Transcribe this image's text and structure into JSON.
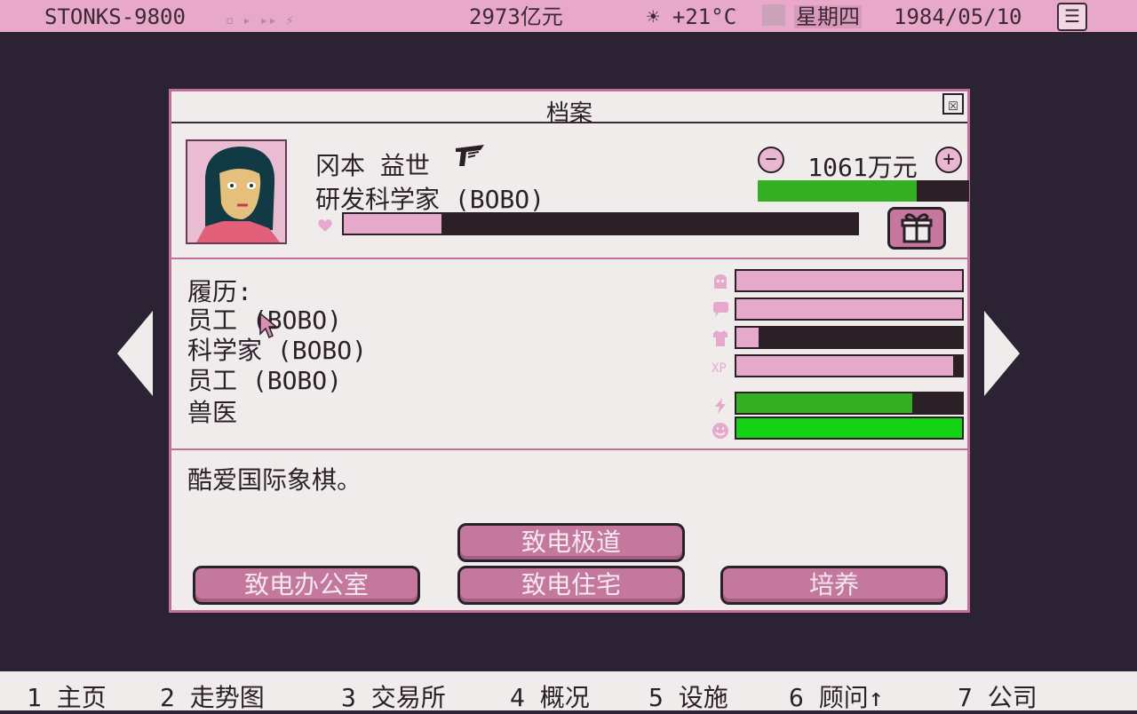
{
  "topbar": {
    "app_name": "STONKS-9800",
    "status_icons": "▫ ▸ ▸▸ ⚡",
    "money": "2973亿元",
    "weather": "☀ +21°C",
    "weekday": "星期四",
    "date": "1984/05/10",
    "menu_icon": "☰"
  },
  "dialog": {
    "title": "档案",
    "close_icon": "☒",
    "employee": {
      "name": "冈本 益世",
      "role": "研发科学家 (BOBO)",
      "loyalty_fraction": 0.19,
      "salary": "1061万元",
      "salary_fraction": 0.75
    },
    "history": {
      "label": "履历:",
      "items": [
        "员工 (BOBO)",
        "科学家 (BOBO)",
        "员工 (BOBO)",
        "兽医"
      ]
    },
    "stats": [
      {
        "icon": "head-icon",
        "fraction": 1.0,
        "color": "#e7a9cb"
      },
      {
        "icon": "speech-icon",
        "fraction": 1.0,
        "color": "#e7a9cb"
      },
      {
        "icon": "shirt-icon",
        "fraction": 0.1,
        "color": "#e7a9cb"
      },
      {
        "icon": "xp-icon",
        "fraction": 0.96,
        "color": "#e7a9cb"
      },
      {
        "icon": "energy-icon",
        "fraction": 0.78,
        "color": "#35b025"
      },
      {
        "icon": "mood-icon",
        "fraction": 1.0,
        "color": "#14d214"
      }
    ],
    "bio": "酷爱国际象棋。",
    "buttons": {
      "call_extreme": "致电极道",
      "call_office": "致电办公室",
      "call_home": "致电住宅",
      "train": "培养"
    }
  },
  "nav": {
    "items": [
      "1 主页",
      "2 走势图",
      "3 交易所",
      "4 概况",
      "5 设施",
      "6 顾问↑",
      "7 公司"
    ]
  }
}
